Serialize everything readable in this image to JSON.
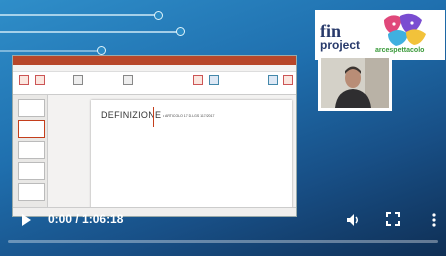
{
  "video": {
    "current_time": "0:00",
    "separator": " / ",
    "duration": "1:06:18",
    "progress": 0.0
  },
  "logos": {
    "fin_project_top": "fin",
    "fin_project_bottom": "project",
    "spettacolo_text": "arcespettacolo"
  },
  "slide": {
    "title": "DEFINIZIONE",
    "subtitle": "• ARTICOLO 17 D.LGS 117/2017"
  },
  "colors": {
    "accent": "#c43e1c",
    "progress": "#ff0000",
    "background": "#1f6fae"
  },
  "icons": {
    "play": "play-icon",
    "volume": "volume-icon",
    "fullscreen": "fullscreen-icon",
    "more": "more-icon"
  }
}
